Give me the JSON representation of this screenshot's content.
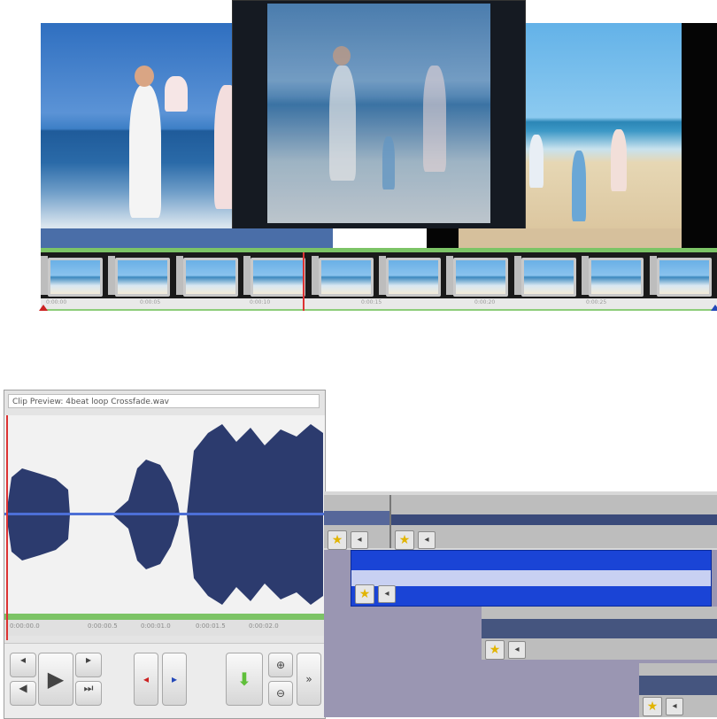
{
  "clip_preview": {
    "title": "Clip Preview: 4beat loop Crossfade.wav",
    "ruler_ticks": [
      "0:00:00.0",
      "0:00:00.5",
      "0:00:01.0",
      "0:00:01.5",
      "0:00:02.0"
    ]
  },
  "filmstrip": {
    "ruler_ticks": [
      "0:00:00",
      "0:00:05",
      "0:00:10",
      "0:00:15",
      "0:00:20",
      "0:00:25"
    ]
  },
  "controls": {
    "play_icon": "play-icon",
    "rewind_icon": "skip-back-icon",
    "forward_icon": "skip-forward-icon",
    "to_start_icon": "to-start-icon",
    "to_end_icon": "to-end-icon",
    "mark_in_icon": "mark-in-icon",
    "mark_out_icon": "mark-out-icon",
    "add_icon": "down-arrow-icon",
    "zoom_in_icon": "zoom-in-icon",
    "zoom_out_icon": "zoom-out-icon",
    "expand_icon": "expand-arrow-icon"
  },
  "tracks": {
    "fx_icon": "star-effect-icon",
    "volume_icon": "volume-icon"
  },
  "colors": {
    "waveform": "#2c3b6e",
    "selected_clip": "#1a44d6",
    "timeline_green": "#7cc466",
    "playhead": "#dd3333"
  }
}
